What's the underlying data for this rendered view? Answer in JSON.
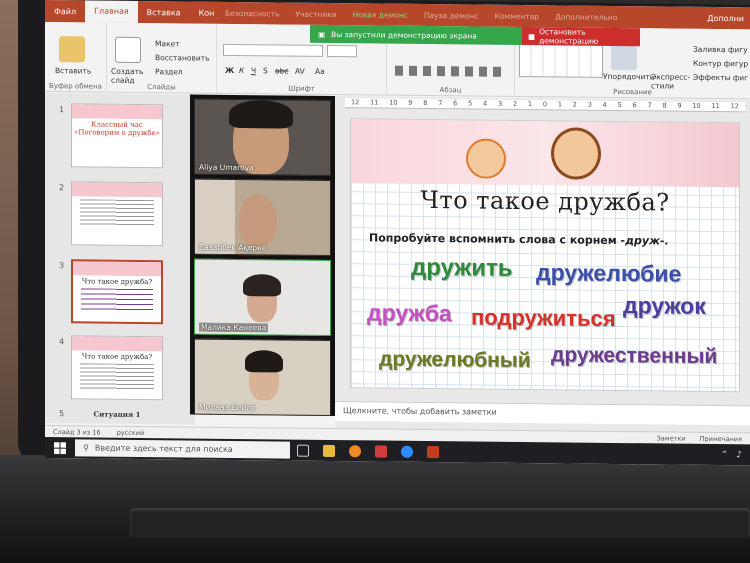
{
  "ribbon": {
    "tabs": [
      "Файл",
      "Главная",
      "Вставка",
      "Кон"
    ],
    "active_tab": "Главная",
    "right_tab": "Дополни",
    "clipboard": {
      "paste": "Вставить",
      "group": "Буфер обмена"
    },
    "slides": {
      "new_slide": "Создать слайд",
      "layout": "Макет",
      "reset": "Восстановить",
      "section": "Раздел",
      "group": "Слайды"
    },
    "font": {
      "group": "Шрифт",
      "buttons": [
        "Ж",
        "К",
        "Ч",
        "S",
        "abc",
        "AV",
        "Aa"
      ]
    },
    "paragraph": {
      "group": "Абзац"
    },
    "drawing": {
      "arrange": "Упорядочить",
      "quick_styles": "Экспресс-стили",
      "fill": "Заливка фигу",
      "outline": "Контур фигур",
      "effects": "Эффекты фиг",
      "group": "Рисование"
    }
  },
  "zoom": {
    "top_items": [
      "Безопасность",
      "Участники",
      "Новая демонс",
      "Пауза демонс",
      "Комментар",
      "Дополнительно"
    ],
    "sharing_notice": "Вы запустили демонстрацию экрана",
    "stop_button": "Остановить демонстрацию"
  },
  "thumbnails": [
    {
      "num": "1",
      "title": "Классный час «Поговорим о дружбе»"
    },
    {
      "num": "2",
      "title": ""
    },
    {
      "num": "3",
      "title": "Что такое дружба?"
    },
    {
      "num": "4",
      "title": "Что такое дружба?"
    },
    {
      "num": "5",
      "title": "Ситуация 1"
    }
  ],
  "participants": [
    {
      "name": "Aliya Umarova",
      "bg": "#5a5550"
    },
    {
      "name": "Базарбек Ақерке",
      "bg": "#b8a894"
    },
    {
      "name": "Малика Канеева",
      "bg": "#e8e6e4"
    },
    {
      "name": "Милана Бейле",
      "bg": "#d9d0c4"
    }
  ],
  "slide": {
    "title": "Что такое дружба?",
    "subtitle_prefix": "Попробуйте вспомнить слова с корнем ",
    "root": "-друж-.",
    "words": [
      {
        "text": "дружить",
        "color": "#2e8b3a"
      },
      {
        "text": "дружелюбие",
        "color": "#3b4fa8"
      },
      {
        "text": "дружба",
        "color": "#c54fc3"
      },
      {
        "text": "подружиться",
        "color": "#d8302a"
      },
      {
        "text": "дружок",
        "color": "#4a3f9e"
      },
      {
        "text": "дружелюбный",
        "color": "#6a7a22"
      },
      {
        "text": "дружественный",
        "color": "#6b3b8e"
      }
    ],
    "ruler": [
      "12",
      "11",
      "10",
      "9",
      "8",
      "7",
      "6",
      "5",
      "4",
      "3",
      "2",
      "1",
      "0",
      "1",
      "2",
      "3",
      "4",
      "5",
      "6",
      "7",
      "8",
      "9",
      "10",
      "11",
      "12"
    ]
  },
  "notes_placeholder": "Щелкните, чтобы добавить заметки",
  "status": {
    "slide": "Слайд 3 из 16",
    "lang": "русский",
    "notes": "Заметки",
    "comments": "Примечания"
  },
  "taskbar": {
    "search": "Введите здесь текст для поиска"
  },
  "colors": {
    "ppt_accent": "#b7472a",
    "zoom_green": "#35a64b",
    "zoom_red": "#cc2d2d"
  }
}
